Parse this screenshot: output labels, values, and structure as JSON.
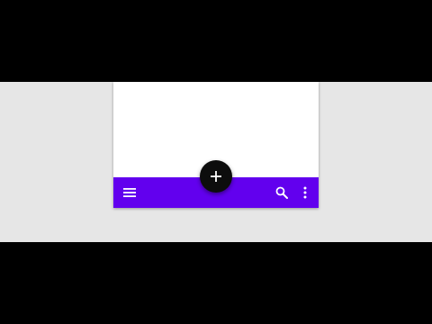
{
  "colors": {
    "bottom_app_bar": "#6200ee",
    "fab": "#0d0d0d",
    "icon": "#ffffff",
    "surface": "#ffffff",
    "backdrop": "#e6e6e6",
    "letterbox": "#000000"
  },
  "bottom_app_bar": {
    "navigation_icon": "menu-icon",
    "actions": [
      "search-icon",
      "more-vert-icon"
    ]
  },
  "fab": {
    "icon": "add-icon"
  }
}
